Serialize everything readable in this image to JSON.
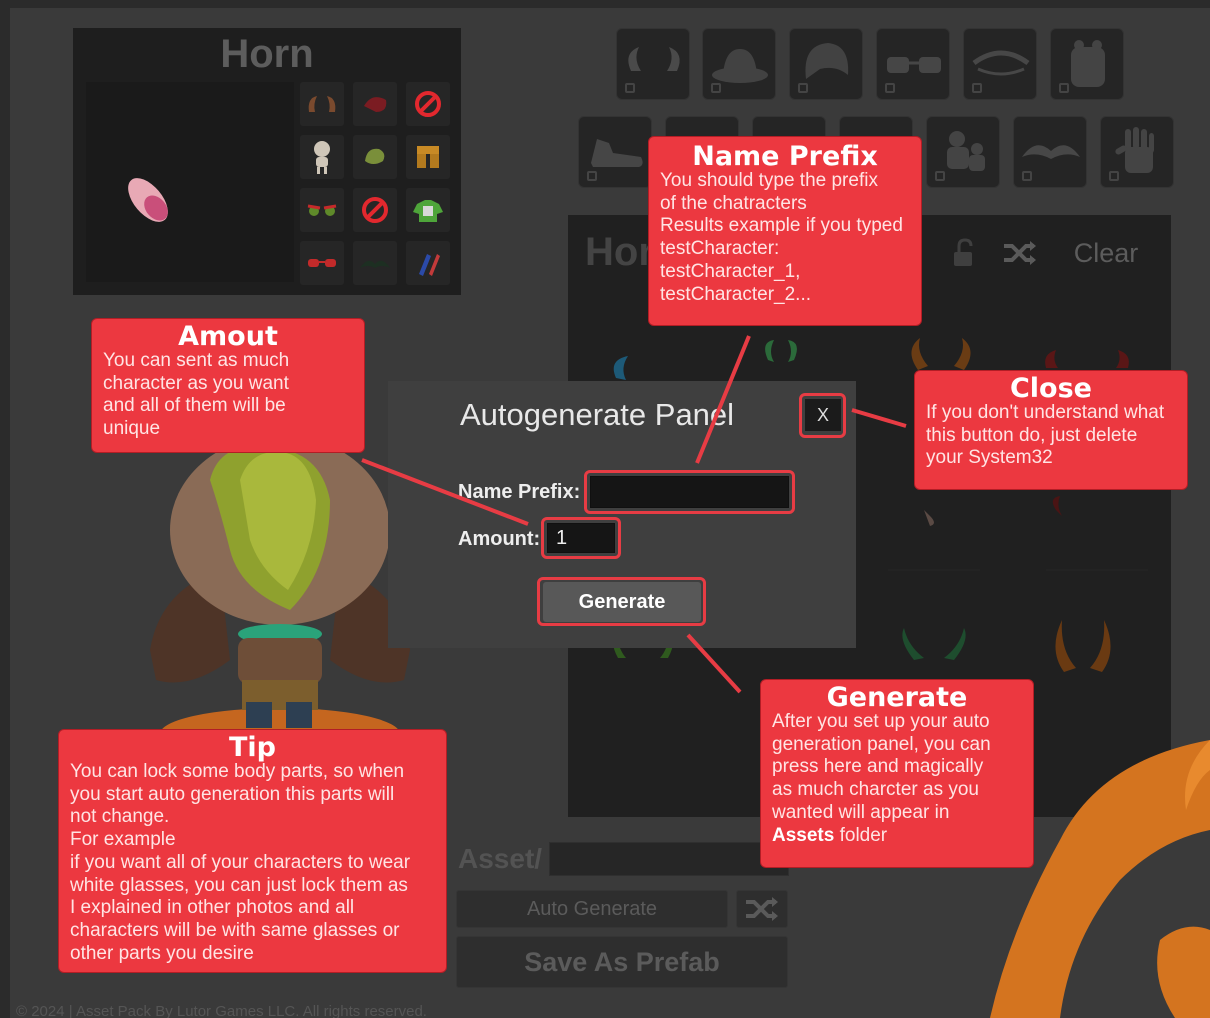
{
  "preview": {
    "title": "Horn"
  },
  "right_panel": {
    "title": "Hor",
    "clear_label": "Clear"
  },
  "modal": {
    "title": "Autogenerate Panel",
    "close_label": "X",
    "name_prefix_label": "Name Prefix:",
    "name_prefix_value": "",
    "amount_label": "Amount:",
    "amount_value": "1",
    "generate_label": "Generate"
  },
  "bottom": {
    "asset_label": "Asset/",
    "auto_generate_label": "Auto Generate",
    "save_prefab_label": "Save As Prefab"
  },
  "footer": "© 2024 | Asset Pack By Lutor Games LLC. All rights reserved.",
  "callouts": {
    "name_prefix": {
      "title": "Name Prefix",
      "lines": [
        "You should type the prefix",
        "of the chatracters",
        "Results example if you typed",
        "testCharacter:",
        "testCharacter_1,",
        "testCharacter_2..."
      ]
    },
    "amount": {
      "title": "Amout",
      "lines": [
        "You can sent as much",
        "character as you want",
        "and all of them will be",
        "unique"
      ]
    },
    "close": {
      "title": "Close",
      "lines": [
        "If you don't understand what",
        "this button do, just delete",
        "your System32"
      ]
    },
    "generate": {
      "title": "Generate",
      "lines": [
        "After you set up your auto",
        "generation panel, you can",
        "press here and magically",
        "as much charcter as you",
        "wanted will appear in"
      ],
      "last_bold": "Assets",
      "last_rest": " folder"
    },
    "tip": {
      "title": "Tip",
      "lines": [
        "You can lock some body parts, so when",
        "you start auto generation this parts will",
        "not change.",
        "For example",
        "if you want all of your characters to wear",
        "white glasses, you can just lock them as",
        "I explained in other photos and all",
        "characters will be with same glasses or",
        "other parts you desire"
      ]
    }
  },
  "icons": [
    "horn-icon",
    "hat-icon",
    "hair-icon",
    "glasses-icon",
    "eye-icon",
    "backpack-icon",
    "shoe-icon",
    "mustache-icon",
    "glove-icon",
    "shuffle-icon",
    "lock-icon"
  ],
  "colors": {
    "callout_red": "#ec3840",
    "highlight_ring": "#e73c44",
    "accent_orange": "#d4741f"
  }
}
